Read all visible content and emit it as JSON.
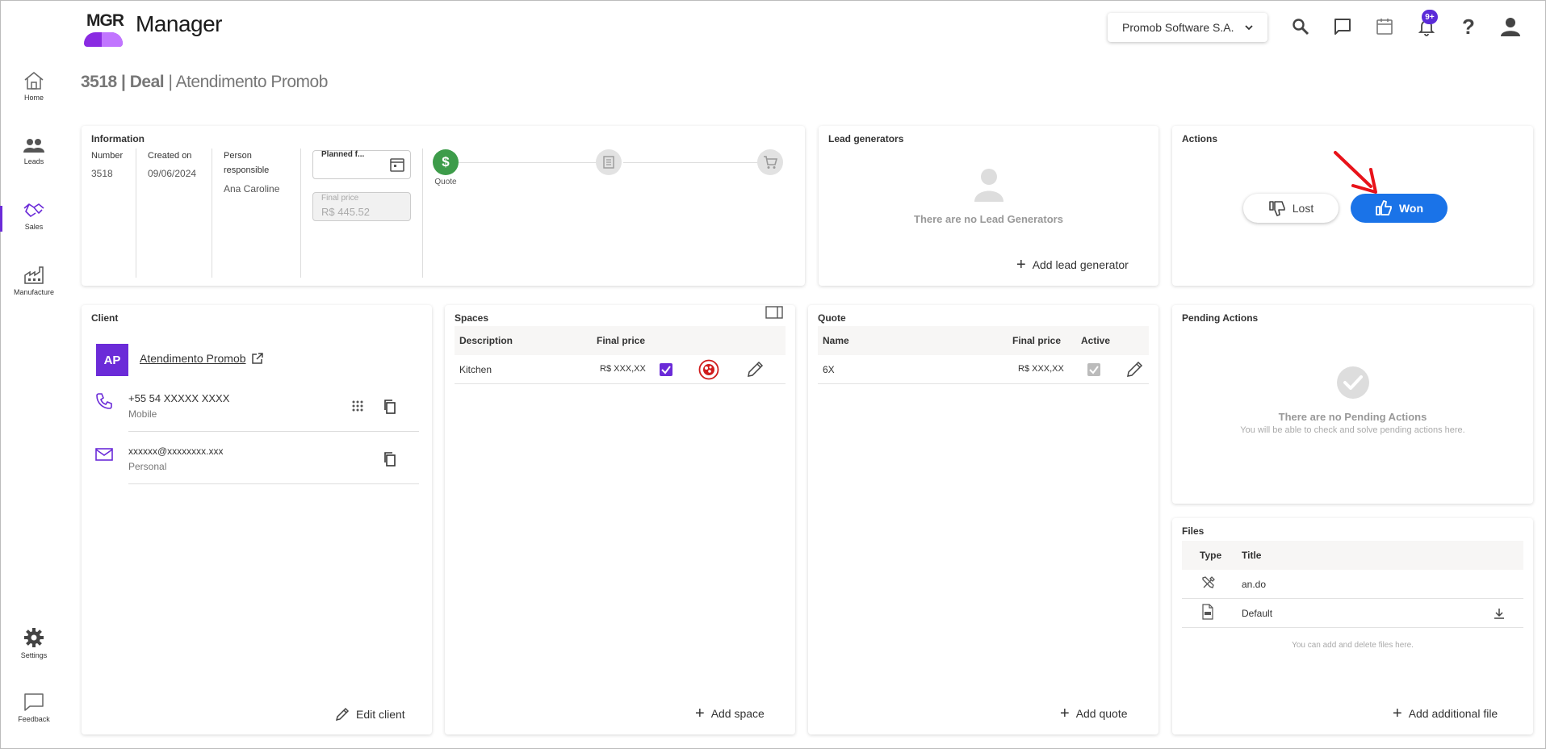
{
  "app": {
    "logo_text": "MGR",
    "title": "Manager"
  },
  "header": {
    "company": "Promob Software S.A.",
    "notification_badge": "9+",
    "icons": [
      "search-icon",
      "chat-icon",
      "calendar-icon",
      "bell-icon",
      "help-icon",
      "account-icon"
    ]
  },
  "nav": {
    "items": [
      {
        "label": "Home",
        "icon": "home-icon"
      },
      {
        "label": "Leads",
        "icon": "people-icon"
      },
      {
        "label": "Sales",
        "icon": "handshake-icon",
        "active": true
      },
      {
        "label": "Manufacture",
        "icon": "factory-icon"
      }
    ],
    "bottom": [
      {
        "label": "Settings",
        "icon": "gear-icon"
      },
      {
        "label": "Feedback",
        "icon": "feedback-icon"
      }
    ],
    "accent": "#6b2bd8"
  },
  "page": {
    "id_type": "3518 | Deal",
    "separator": " | ",
    "name": "Atendimento Promob"
  },
  "information": {
    "title": "Information",
    "number_label": "Number",
    "number": "3518",
    "created_label": "Created on",
    "created": "09/06/2024",
    "person_label": "Person responsible",
    "person": "Ana Caroline",
    "planned_label": "Planned f...",
    "final_price_label": "Final price",
    "final_price": "R$ 445.52",
    "steps": [
      {
        "label": "Quote",
        "icon": "dollar-icon",
        "active": true
      },
      {
        "label": "",
        "icon": "document-icon",
        "active": false
      },
      {
        "label": "",
        "icon": "cart-icon",
        "active": false
      }
    ],
    "step_active_color": "#3d9c4a"
  },
  "lead_generators": {
    "title": "Lead generators",
    "empty_text": "There are no Lead Generators",
    "add_label": "Add lead generator"
  },
  "actions": {
    "title": "Actions",
    "lost_label": "Lost",
    "won_label": "Won",
    "won_color": "#1a73e8",
    "annotation_color": "#e8131a"
  },
  "client": {
    "title": "Client",
    "initials": "AP",
    "name": "Atendimento Promob",
    "phone": "+55 54 XXXXX XXXX",
    "phone_type": "Mobile",
    "email": "xxxxxx@xxxxxxxx.xxx",
    "email_type": "Personal",
    "edit_label": "Edit client",
    "avatar_color": "#6b2bd8"
  },
  "spaces": {
    "title": "Spaces",
    "columns": [
      "Description",
      "Final price"
    ],
    "rows": [
      {
        "description": "Kitchen",
        "price": "R$ XXX,XX",
        "checked": true
      }
    ],
    "add_label": "Add space"
  },
  "quote": {
    "title": "Quote",
    "columns": [
      "Name",
      "Final price",
      "Active"
    ],
    "rows": [
      {
        "name": "6X",
        "price": "R$ XXX,XX",
        "active": true
      }
    ],
    "add_label": "Add quote"
  },
  "pending": {
    "title": "Pending Actions",
    "empty_title": "There are no Pending Actions",
    "empty_sub": "You will be able to check and solve pending actions here."
  },
  "files": {
    "title": "Files",
    "columns": [
      "Type",
      "Title"
    ],
    "rows": [
      {
        "type_icon": "tools-icon",
        "title": "an.do"
      },
      {
        "type_icon": "pdf-icon",
        "title": "Default"
      }
    ],
    "note": "You can add and delete files here.",
    "add_label": "Add additional file"
  }
}
